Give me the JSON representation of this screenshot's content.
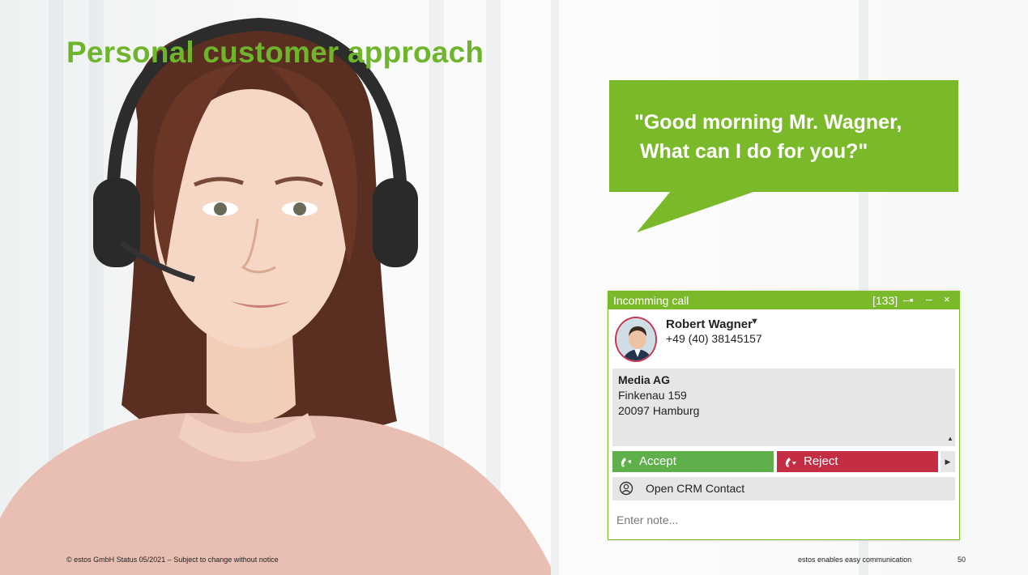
{
  "slide": {
    "title": "Personal customer approach",
    "speech_bubble": "\"Good morning Mr. Wagner,\n What can I do for you?\"",
    "footer_left": "© estos GmbH Status 05/2021 – Subject to change without notice",
    "footer_right": "estos enables easy communication",
    "page_number": "50"
  },
  "call_window": {
    "title": "Incomming call",
    "count": "[133]",
    "caller": {
      "name": "Robert Wagner",
      "phone": "+49 (40) 38145157"
    },
    "address": {
      "company": "Media AG",
      "street": "Finkenau 159",
      "city": "20097 Hamburg"
    },
    "accept_label": "Accept",
    "reject_label": "Reject",
    "crm_label": "Open CRM Contact",
    "note_placeholder": "Enter note..."
  },
  "colors": {
    "brand_green": "#7ab929",
    "title_green": "#6fb52c",
    "accept_green": "#5fb04a",
    "reject_red": "#c52d45"
  }
}
